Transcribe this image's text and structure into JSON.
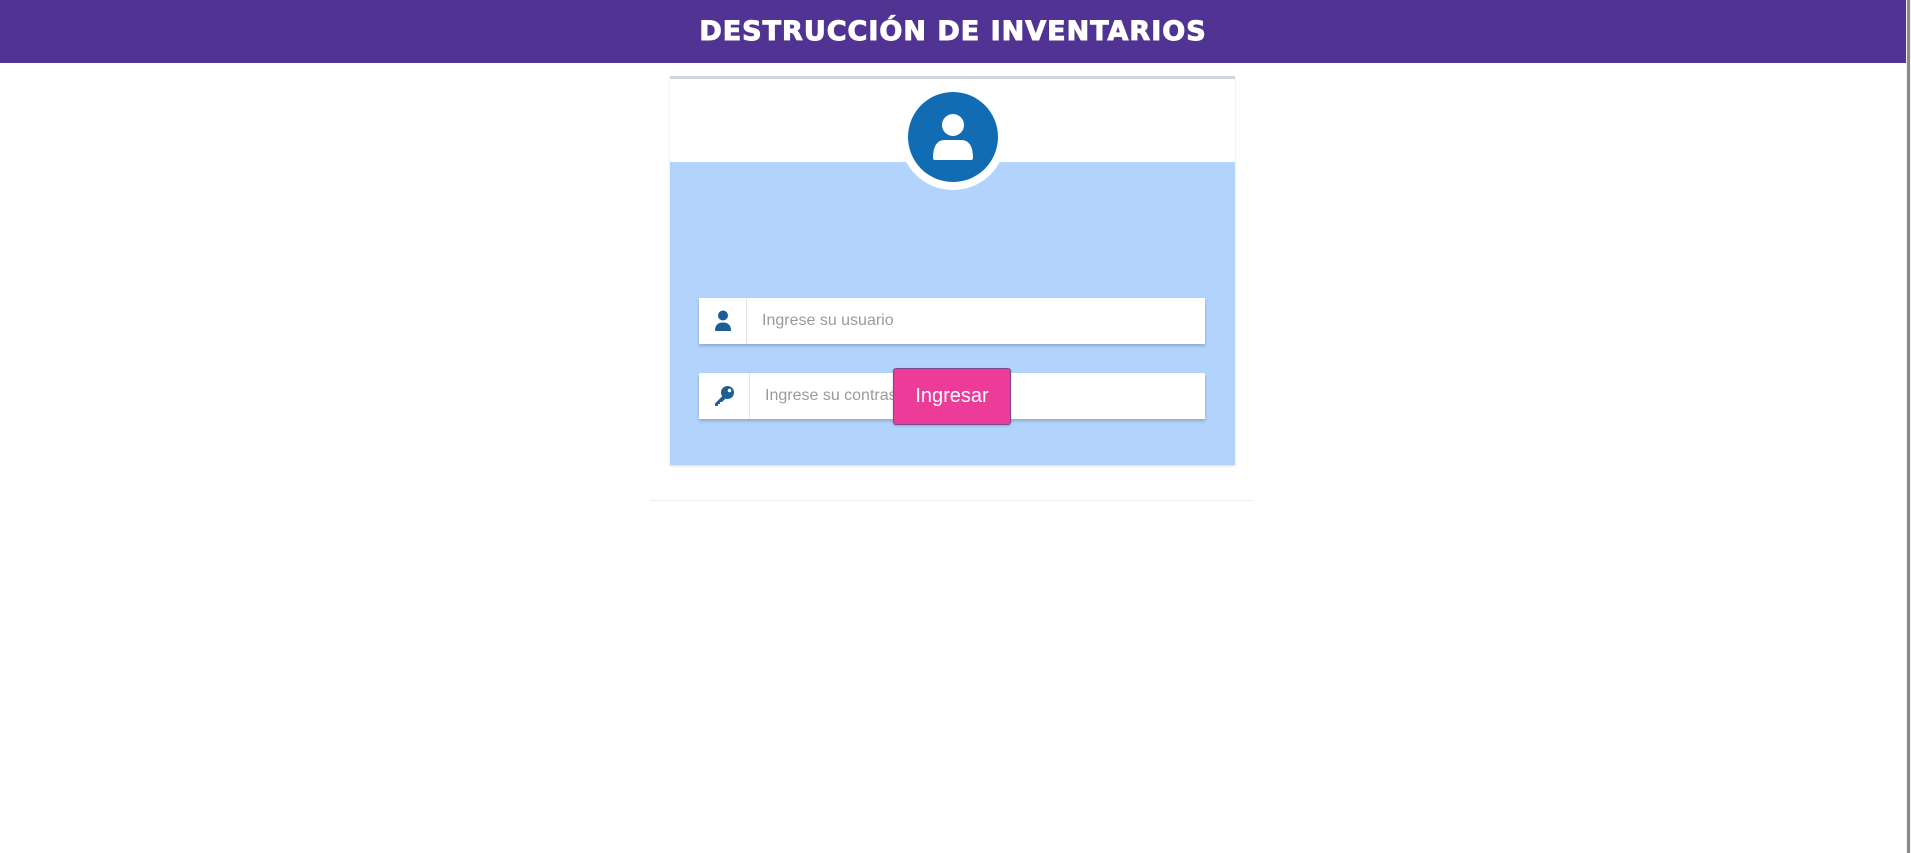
{
  "header": {
    "title": "DESTRUCCIÓN DE INVENTARIOS"
  },
  "login": {
    "avatar_icon": "user-circle-icon",
    "username": {
      "icon": "user-icon",
      "placeholder": "Ingrese su usuario",
      "value": ""
    },
    "password": {
      "icon": "key-icon",
      "placeholder": "Ingrese su contraseña",
      "value": ""
    },
    "submit_label": "Ingresar"
  },
  "colors": {
    "brand": "#503392",
    "panel": "#b2d3fb",
    "avatar": "#126cb3",
    "accent": "#ec3b99",
    "icon": "#1f5e95"
  }
}
